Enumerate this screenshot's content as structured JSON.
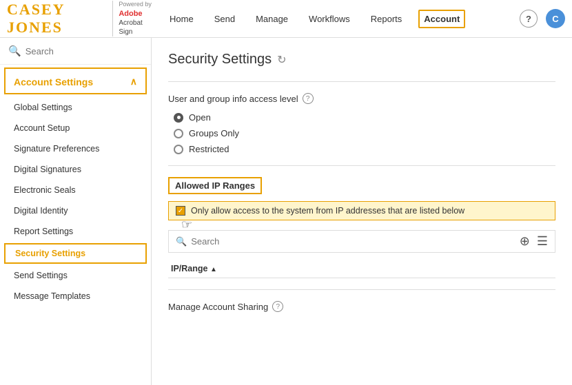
{
  "logo": {
    "name": "CASEY  JONES",
    "powered_by": "Powered by",
    "product_line1": "Adobe",
    "product_line2": "Acrobat Sign"
  },
  "nav": {
    "links": [
      "Home",
      "Send",
      "Manage",
      "Workflows",
      "Reports",
      "Account"
    ],
    "active": "Account"
  },
  "sidebar": {
    "search_placeholder": "Search",
    "section_title": "Account Settings",
    "items": [
      {
        "label": "Global Settings",
        "active": false
      },
      {
        "label": "Account Setup",
        "active": false
      },
      {
        "label": "Signature Preferences",
        "active": false
      },
      {
        "label": "Digital Signatures",
        "active": false
      },
      {
        "label": "Electronic Seals",
        "active": false
      },
      {
        "label": "Digital Identity",
        "active": false
      },
      {
        "label": "Report Settings",
        "active": false
      },
      {
        "label": "Security Settings",
        "active": true
      },
      {
        "label": "Send Settings",
        "active": false
      },
      {
        "label": "Message Templates",
        "active": false
      }
    ]
  },
  "content": {
    "page_title": "Security Settings",
    "user_group_label": "User and group info access level",
    "radio_options": [
      {
        "label": "Open",
        "selected": true
      },
      {
        "label": "Groups Only",
        "selected": false
      },
      {
        "label": "Restricted",
        "selected": false
      }
    ],
    "allowed_ip": {
      "title": "Allowed IP Ranges",
      "checkbox_label": "Only allow access to the system from IP addresses that are listed below",
      "search_placeholder": "Search",
      "table_headers": [
        {
          "label": "IP/Range",
          "sortable": true
        }
      ]
    },
    "manage_sharing": {
      "label": "Manage Account Sharing"
    }
  }
}
